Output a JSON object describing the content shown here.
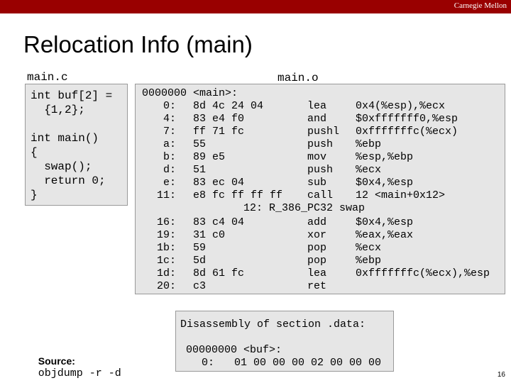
{
  "header": {
    "brand": "Carnegie Mellon"
  },
  "title": "Relocation Info (main)",
  "source_file_label": "main.c",
  "object_file_label": "main.o",
  "source_code": [
    "int buf[2] =",
    "  {1,2};",
    "",
    "int main()",
    "{",
    "  swap();",
    "  return 0;",
    "}"
  ],
  "disassembly": {
    "header": "0000000 <main>:",
    "rows": [
      {
        "addr": "0:",
        "bytes": "8d 4c 24 04",
        "op": "lea",
        "args": "0x4(%esp),%ecx"
      },
      {
        "addr": "4:",
        "bytes": "83 e4 f0",
        "op": "and",
        "args": "$0xfffffff0,%esp"
      },
      {
        "addr": "7:",
        "bytes": "ff 71 fc",
        "op": "pushl",
        "args": "0xfffffffc(%ecx)"
      },
      {
        "addr": "a:",
        "bytes": "55",
        "op": "push",
        "args": "%ebp"
      },
      {
        "addr": "b:",
        "bytes": "89 e5",
        "op": "mov",
        "args": "%esp,%ebp"
      },
      {
        "addr": "d:",
        "bytes": "51",
        "op": "push",
        "args": "%ecx"
      },
      {
        "addr": "e:",
        "bytes": "83 ec 04",
        "op": "sub",
        "args": "$0x4,%esp"
      },
      {
        "addr": "11:",
        "bytes": "e8 fc ff ff ff",
        "op": "call",
        "args": "12 <main+0x12>"
      }
    ],
    "relocation": "12: R_386_PC32 swap",
    "rows2": [
      {
        "addr": "16:",
        "bytes": "83 c4 04",
        "op": "add",
        "args": "$0x4,%esp"
      },
      {
        "addr": "19:",
        "bytes": "31 c0",
        "op": "xor",
        "args": "%eax,%eax"
      },
      {
        "addr": "1b:",
        "bytes": "59",
        "op": "pop",
        "args": "%ecx"
      },
      {
        "addr": "1c:",
        "bytes": "5d",
        "op": "pop",
        "args": "%ebp"
      },
      {
        "addr": "1d:",
        "bytes": "8d 61 fc",
        "op": "lea",
        "args": "0xfffffffc(%ecx),%esp"
      },
      {
        "addr": "20:",
        "bytes": "c3",
        "op": "ret",
        "args": ""
      }
    ]
  },
  "data_section": {
    "title": "Disassembly of section .data:",
    "symbol": "00000000 <buf>:",
    "addr": "0:",
    "bytes": "01 00 00 00 02 00 00 00"
  },
  "source_line": {
    "label": "Source:",
    "command": "objdump -r -d"
  },
  "page_number": "16"
}
